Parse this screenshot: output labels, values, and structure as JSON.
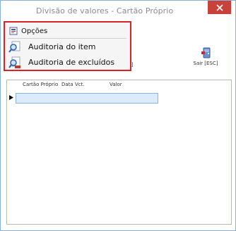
{
  "window": {
    "title": "Divisão de valores - Cartão Próprio",
    "close_icon": "close-icon"
  },
  "toolbar": {
    "sair_label": "Sair [ESC]",
    "sair_icon": "exit-icon",
    "ghost_label": "[I]"
  },
  "grid": {
    "columns": [
      "Cartão Próprio",
      "Data Vct.",
      "Valor"
    ]
  },
  "menu": {
    "header_label": "Opções",
    "items": [
      {
        "label": "Auditoria do item",
        "icon": "magnifier-icon"
      },
      {
        "label": "Auditoria de excluídos",
        "icon": "magnifier-deleted-icon"
      }
    ],
    "highlight_color": "#d8232a"
  }
}
